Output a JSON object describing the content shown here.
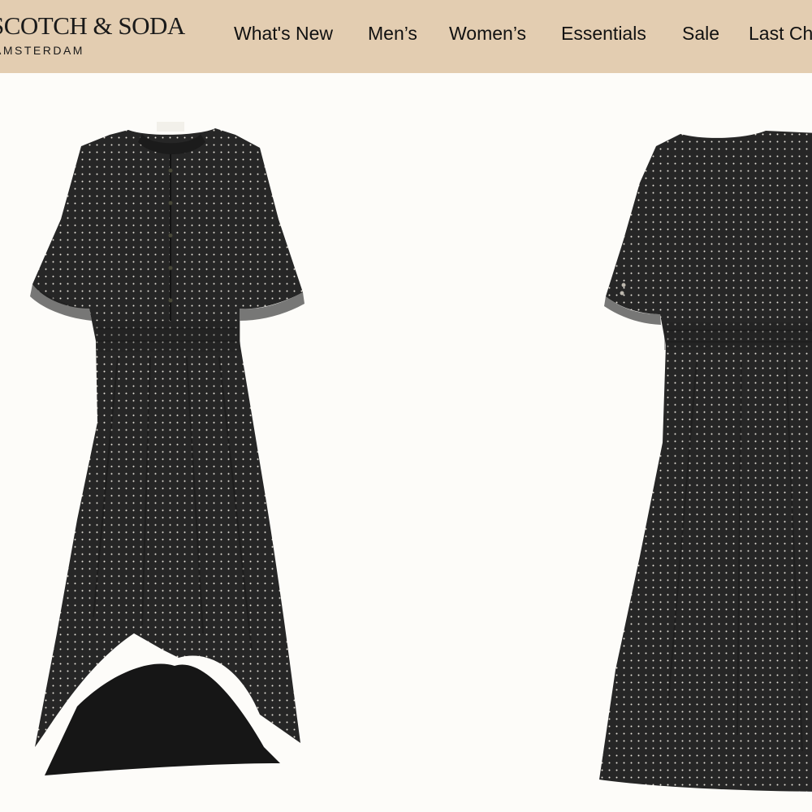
{
  "header": {
    "logo": {
      "main": "SCOTCH & SODA",
      "sub": "AMSTERDAM"
    },
    "nav": [
      {
        "label": "What's New"
      },
      {
        "label": "Men’s"
      },
      {
        "label": "Women’s"
      },
      {
        "label": "Essentials"
      },
      {
        "label": "Sale"
      },
      {
        "label": "Last Chance"
      }
    ]
  },
  "gallery": {
    "images": [
      {
        "view": "front",
        "color": "#262626",
        "pattern_color": "#e8e4dc"
      },
      {
        "view": "back",
        "color": "#262626",
        "pattern_color": "#e8e4dc"
      }
    ]
  },
  "colors": {
    "header_bg": "#e3cdb1",
    "page_bg": "#fdfcf9",
    "text": "#111111"
  }
}
